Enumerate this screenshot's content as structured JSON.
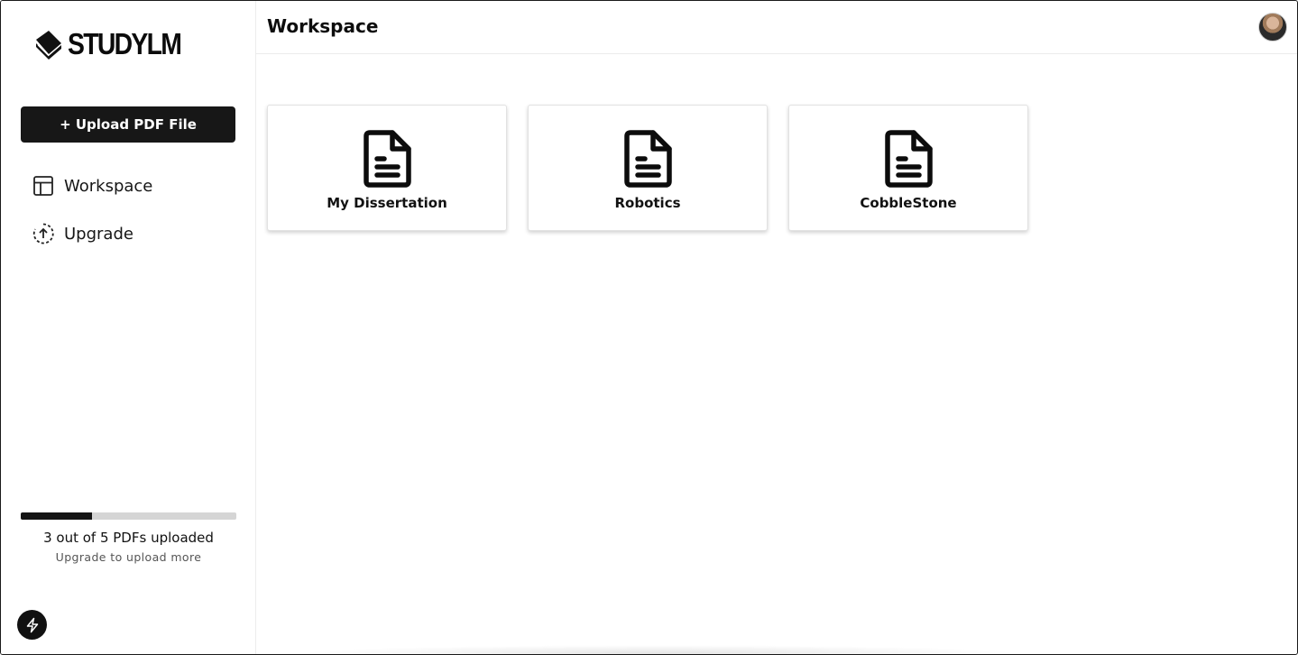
{
  "app": {
    "logo_text": "STUDYLM"
  },
  "sidebar": {
    "upload_label": "+ Upload PDF File",
    "items": [
      {
        "label": "Workspace",
        "icon": "layout-icon"
      },
      {
        "label": "Upgrade",
        "icon": "upload-circle-icon"
      }
    ],
    "usage": {
      "uploaded": 3,
      "limit": 5,
      "progress_fraction": 0.33,
      "main_text": "3 out of 5 PDFs uploaded",
      "sub_text": "Upgrade to upload more"
    }
  },
  "header": {
    "title": "Workspace"
  },
  "files": [
    {
      "name": "My Dissertation",
      "icon": "document-icon"
    },
    {
      "name": "Robotics",
      "icon": "document-icon"
    },
    {
      "name": "CobbleStone",
      "icon": "document-icon"
    }
  ],
  "colors": {
    "primary": "#171717",
    "progress_track": "#d5d5d5",
    "border": "#ececec"
  }
}
